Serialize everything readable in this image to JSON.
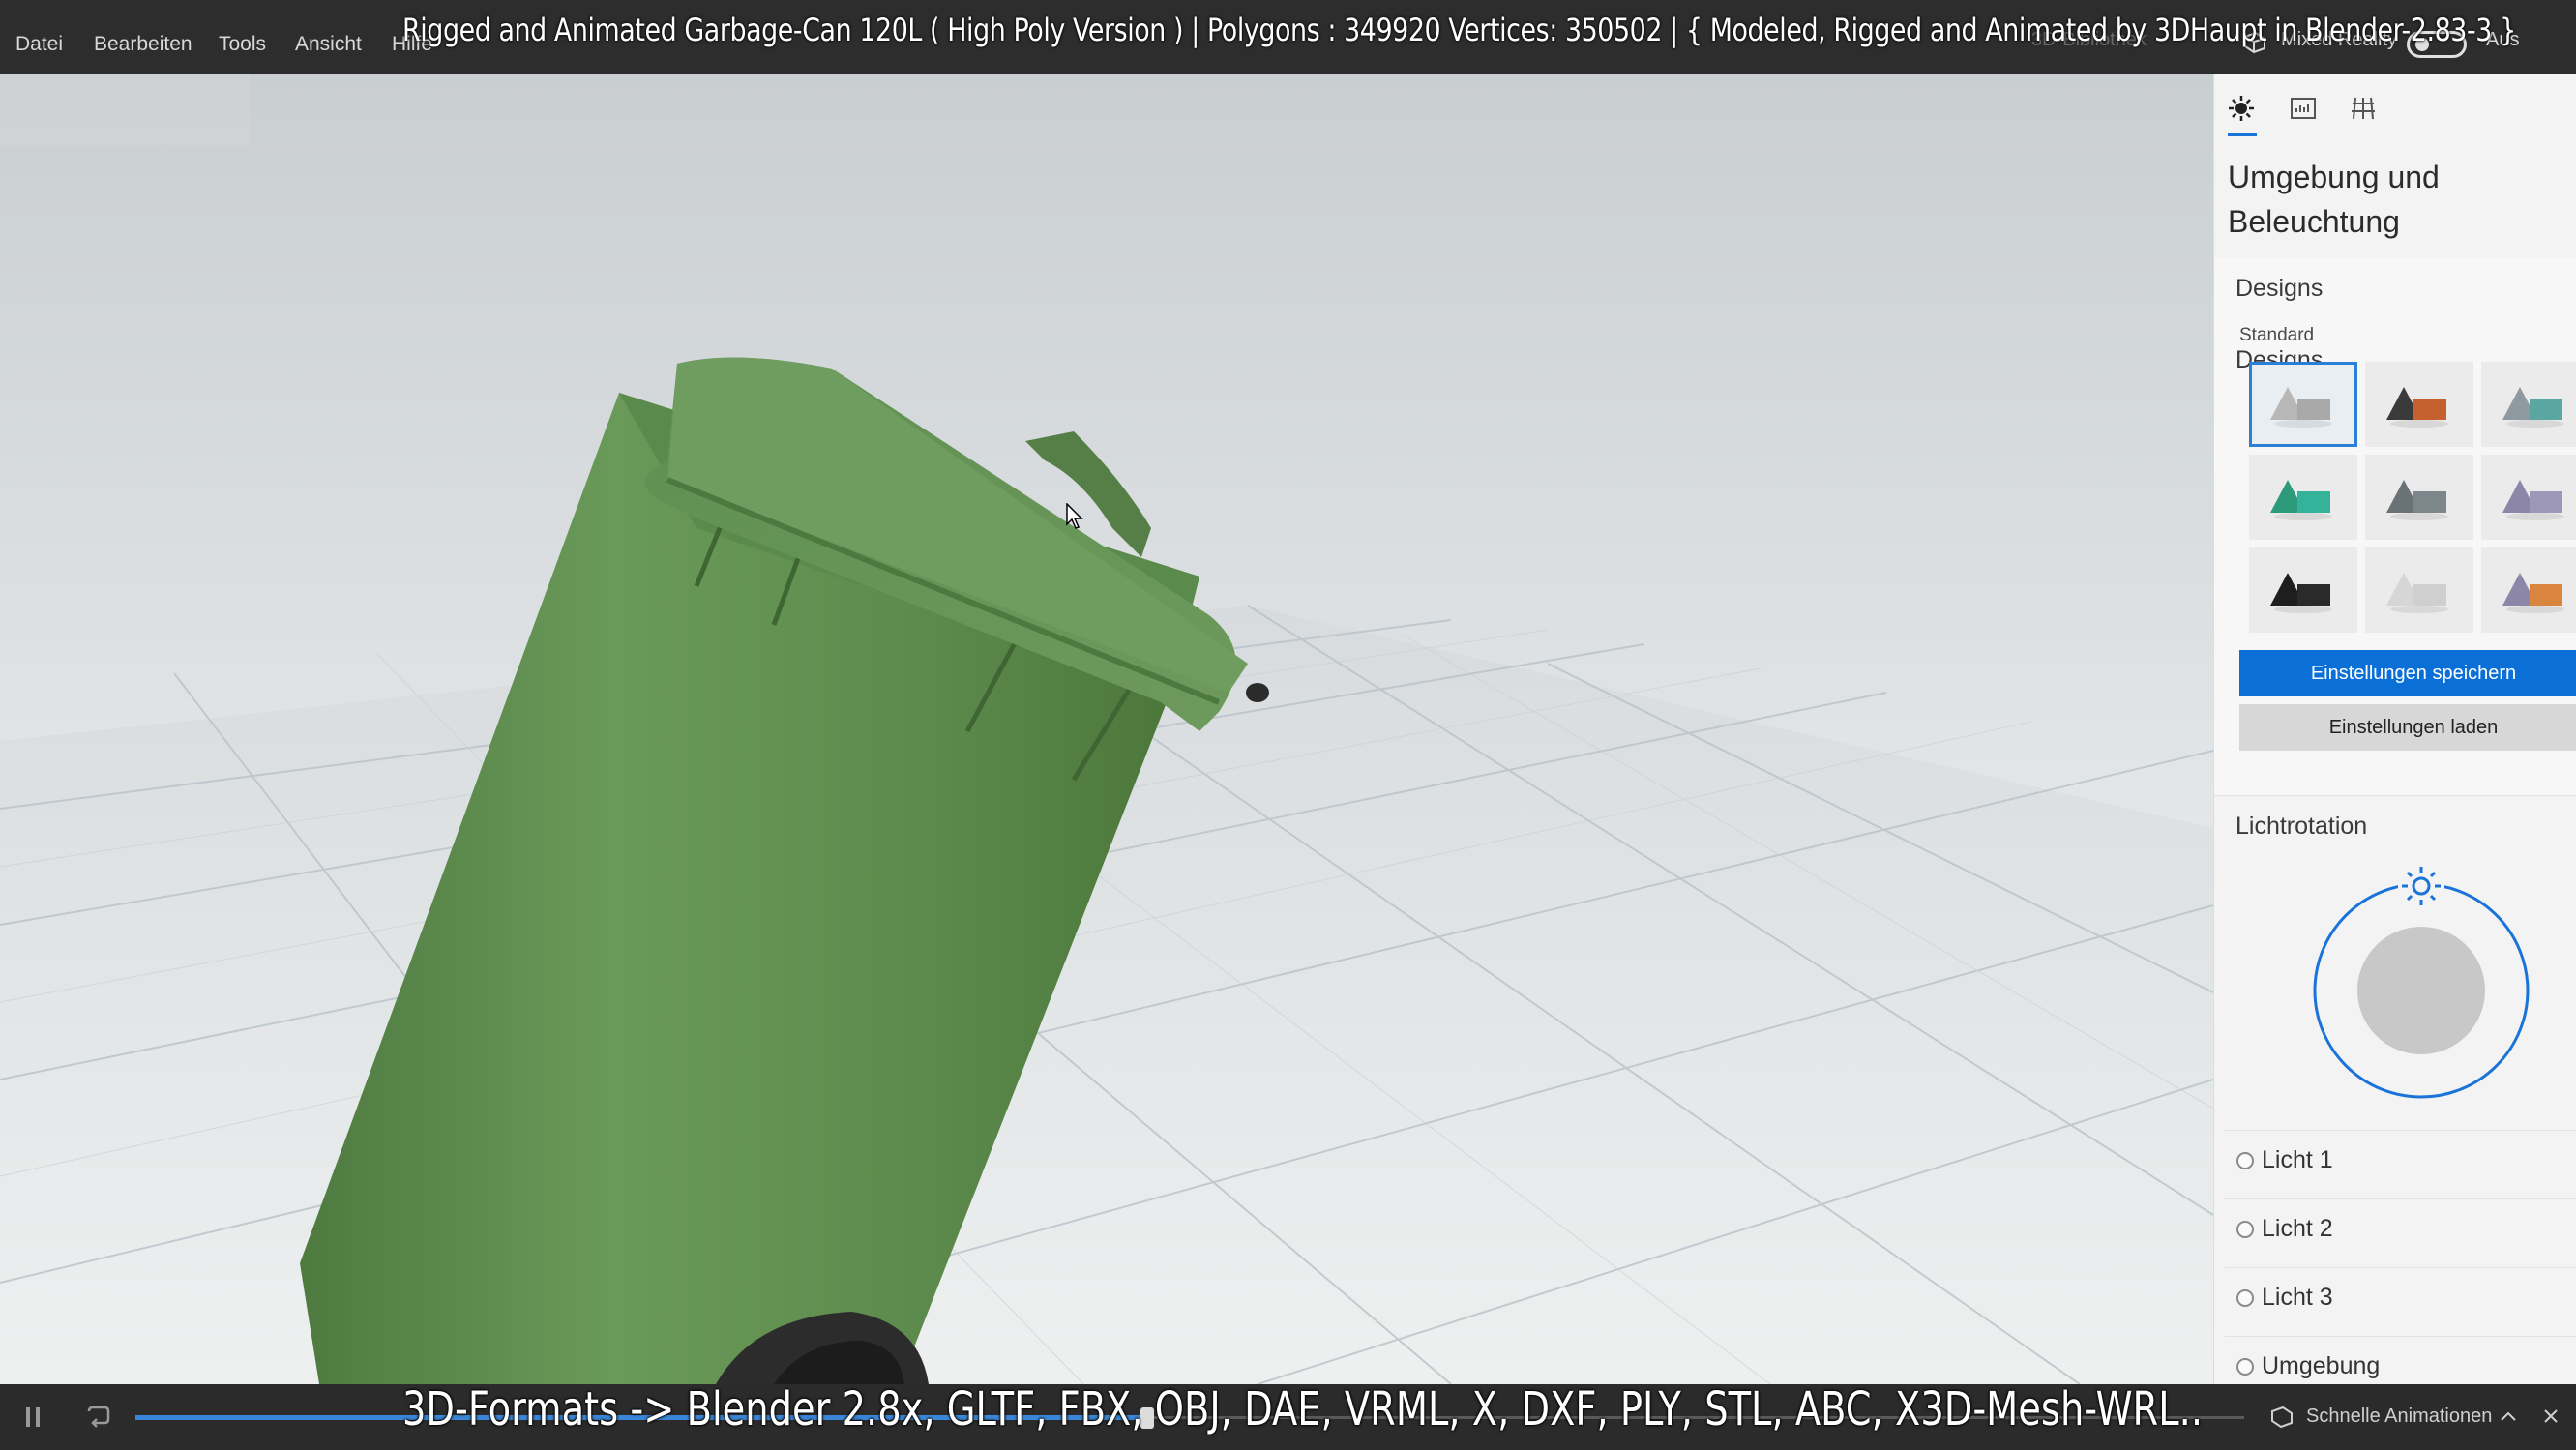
{
  "menu": {
    "items": [
      "Datei",
      "Bearbeiten",
      "Tools",
      "Ansicht",
      "Hilfe"
    ],
    "library_label": "3D-Bibliothek",
    "mixed_reality_label": "Mixed Reality",
    "toggle_state": "Aus"
  },
  "overlay": {
    "title": "Rigged and Animated Garbage-Can 120L ( High Poly Version )  |  Polygons : 349920  Vertices: 350502   |   { Modeled, Rigged and Animated by 3DHaupt in Blender-2.83-3 }",
    "formats": "3D-Formats -> Blender 2.8x, GLTF, FBX, OBJ, DAE, VRML, X, DXF, PLY, STL, ABC, X3D-Mesh-WRL.."
  },
  "panel": {
    "tabs": [
      "environment-tab",
      "stats-tab",
      "grid-tab"
    ],
    "heading_line1": "Umgebung und",
    "heading_line2": "Beleuchtung",
    "designs_title": "Designs",
    "designs_group": "Standard",
    "swatches": [
      {
        "id": "grey",
        "cone": "#b7b7b7",
        "box": "#a9a9a9"
      },
      {
        "id": "dark-orange",
        "cone": "#3a3a3a",
        "box": "#c4612e"
      },
      {
        "id": "teal-grey",
        "cone": "#8f9aa0",
        "box": "#5aa6a0"
      },
      {
        "id": "teal",
        "cone": "#2e9a7c",
        "box": "#34b29a"
      },
      {
        "id": "slate",
        "cone": "#6b7276",
        "box": "#7d868a"
      },
      {
        "id": "lilac",
        "cone": "#8c86a8",
        "box": "#9d97b8"
      },
      {
        "id": "black",
        "cone": "#1e1e1e",
        "box": "#2a2a2a"
      },
      {
        "id": "light",
        "cone": "#d6d6d6",
        "box": "#cfcfcf"
      },
      {
        "id": "orange-lilac",
        "cone": "#8c86a8",
        "box": "#d9843f"
      }
    ],
    "save_button": "Einstellungen speichern",
    "load_button": "Einstellungen laden",
    "light_rotation_title": "Lichtrotation",
    "lights": [
      "Licht 1",
      "Licht 2",
      "Licht 3",
      "Umgebung"
    ],
    "accent_color": "#0a6fd6"
  },
  "bottom": {
    "quick_animations_label": "Schnelle Animationen",
    "progress": 0.48
  }
}
